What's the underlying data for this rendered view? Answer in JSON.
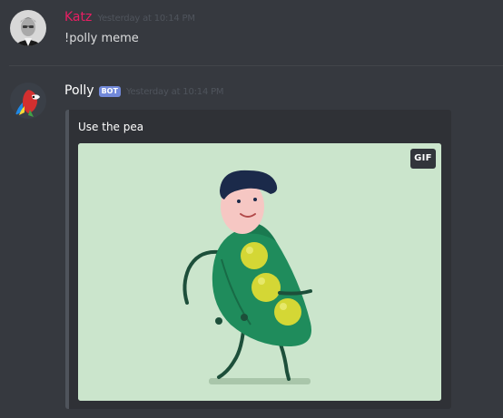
{
  "messages": [
    {
      "author": "Katz",
      "author_color": "#e91e63",
      "timestamp": "Yesterday at 10:14 PM",
      "text": "!polly meme"
    },
    {
      "author": "Polly",
      "author_color": "#ffffff",
      "bot_tag": "BOT",
      "timestamp": "Yesterday at 10:14 PM",
      "embed": {
        "title": "Use the pea",
        "gif_badge": "GIF",
        "image_icon": "pea-character-animation"
      }
    }
  ],
  "colors": {
    "background": "#36393f",
    "embed_background": "#2f3136",
    "bot_tag": "#7289da",
    "gif_background": "#cbe5cc"
  }
}
